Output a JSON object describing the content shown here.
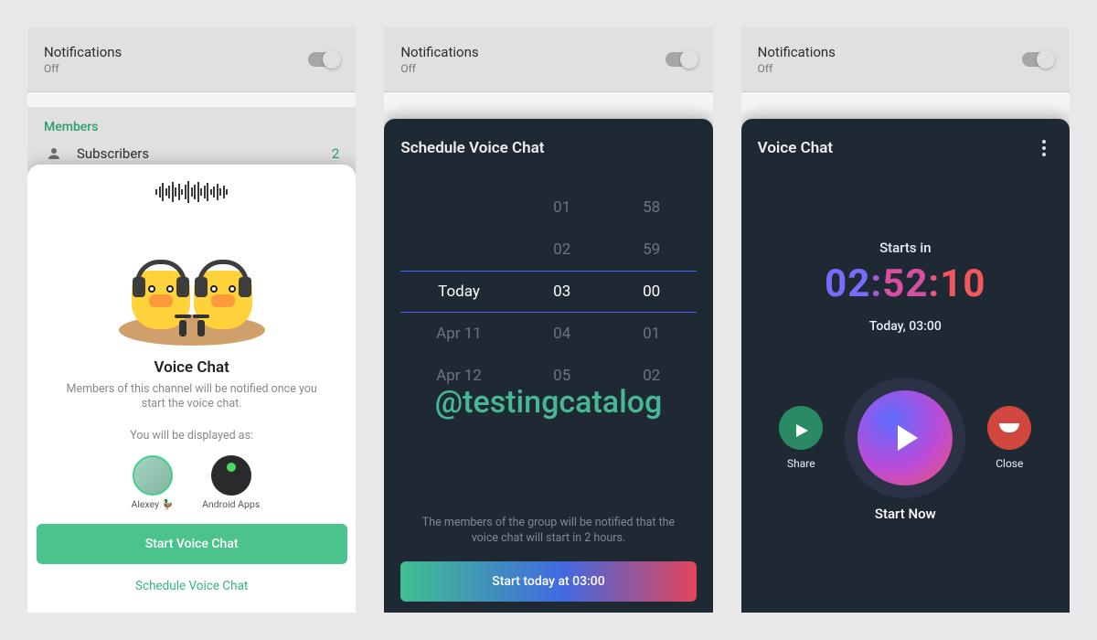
{
  "watermark": "@testingcatalog",
  "notifications": {
    "title": "Notifications",
    "state": "Off"
  },
  "screen1": {
    "members_header": "Members",
    "subscribers_label": "Subscribers",
    "subscribers_count": "2",
    "sheet_title": "Voice Chat",
    "sheet_desc": "Members of this channel will be notified once you start the voice chat.",
    "displayed_as": "You will be displayed as:",
    "avatars": [
      {
        "name": "Alexey 🦆"
      },
      {
        "name": "Android Apps"
      }
    ],
    "start_button": "Start Voice Chat",
    "schedule_link": "Schedule Voice Chat"
  },
  "screen2": {
    "title": "Schedule Voice Chat",
    "cols": {
      "date": [
        "",
        "",
        "Today",
        "Apr 11",
        "Apr 12"
      ],
      "hour": [
        "01",
        "02",
        "03",
        "04",
        "05"
      ],
      "minute": [
        "58",
        "59",
        "00",
        "01",
        "02"
      ]
    },
    "notice": "The members of the group will be notified that the voice chat will start in 2 hours.",
    "cta": "Start today at 03:00"
  },
  "screen3": {
    "title": "Voice Chat",
    "starts_in": "Starts in",
    "countdown": {
      "h": "02",
      "m": "52",
      "s": "10"
    },
    "when": "Today, 03:00",
    "share": "Share",
    "close": "Close",
    "start_now": "Start Now"
  }
}
